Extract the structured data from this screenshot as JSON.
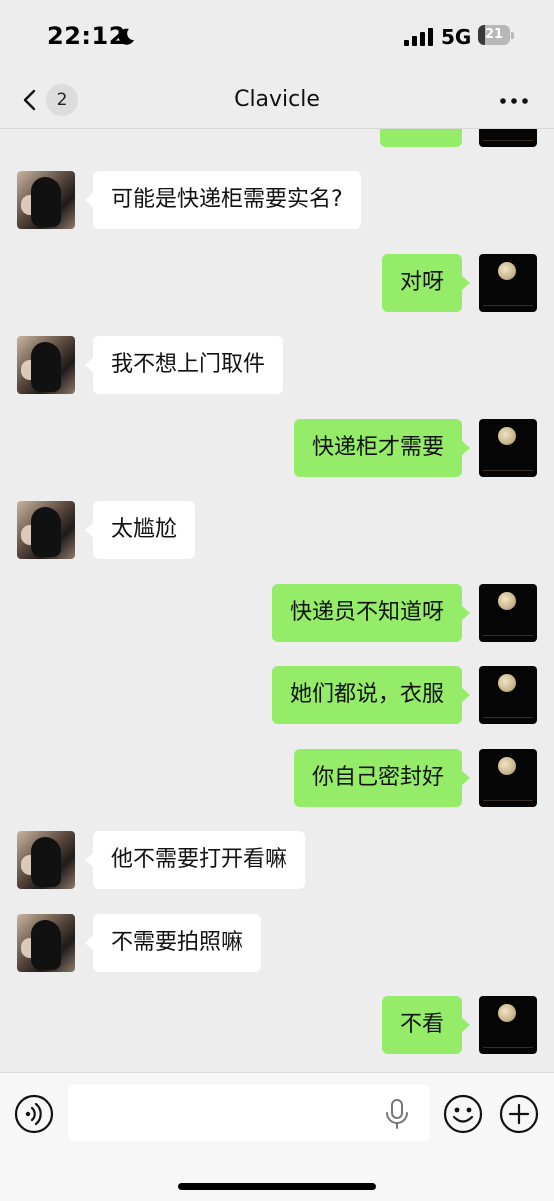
{
  "status_bar": {
    "time": "22:12",
    "network": "5G",
    "battery_level": "21",
    "battery_fraction": 0.21,
    "icons": [
      "moon-icon",
      "cellular-signal-icon",
      "battery-icon"
    ]
  },
  "header": {
    "title": "Clavicle",
    "unread_count": "2",
    "icons": [
      "back-chevron-icon",
      "more-icon"
    ]
  },
  "messages": [
    {
      "from": "contact",
      "text": "可能是快递柜需要实名?"
    },
    {
      "from": "me",
      "text": "对呀"
    },
    {
      "from": "contact",
      "text": "我不想上门取件"
    },
    {
      "from": "me",
      "text": "快递柜才需要"
    },
    {
      "from": "contact",
      "text": "太尴尬"
    },
    {
      "from": "me",
      "text": "快递员不知道呀"
    },
    {
      "from": "me",
      "text": "她们都说，衣服"
    },
    {
      "from": "me",
      "text": "你自己密封好"
    },
    {
      "from": "contact",
      "text": "他不需要打开看嘛"
    },
    {
      "from": "contact",
      "text": "不需要拍照嘛"
    },
    {
      "from": "me",
      "text": "不看"
    }
  ],
  "input_bar": {
    "message_value": "",
    "icons": [
      "voice-icon",
      "microphone-icon",
      "emoji-icon",
      "add-icon"
    ]
  },
  "colors": {
    "background": "#ededed",
    "incoming_bubble": "#ffffff",
    "outgoing_bubble": "#95ec69",
    "input_bar": "#f7f7f7"
  }
}
